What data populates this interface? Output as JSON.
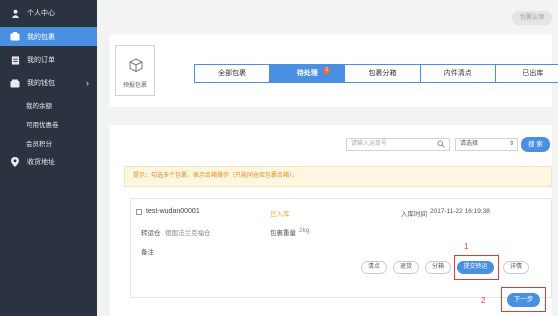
{
  "sidebar": {
    "items": [
      {
        "label": "个人中心",
        "icon": "user-icon"
      },
      {
        "label": "我的包裹",
        "icon": "package-icon"
      },
      {
        "label": "我的订单",
        "icon": "order-icon"
      },
      {
        "label": "我的钱包",
        "icon": "wallet-icon"
      }
    ],
    "wallet_sub": [
      "我的余额",
      "可用优惠卷",
      "会员积分"
    ],
    "address": {
      "label": "收货地址",
      "icon": "location-icon"
    }
  },
  "header": {
    "help_label": "包裹认领"
  },
  "top_card": {
    "pre_package_label": "预报包裹",
    "tabs": [
      {
        "label": "全部包裹"
      },
      {
        "label": "待处理",
        "badge": "1"
      },
      {
        "label": "包裹分箱"
      },
      {
        "label": "内件清点"
      },
      {
        "label": "已出库"
      }
    ]
  },
  "filters": {
    "search_placeholder": "请输入运单号",
    "select_value": "请选择",
    "search_button": "搜 索"
  },
  "tip": "提示：勾选多个包裹，表示合箱操作（只能同仓库包裹合箱）。",
  "package": {
    "tracking_no": "test-wudan00001",
    "status": "已入库",
    "in_time_label": "入库时间",
    "in_time_value": "2017-11-22 16:19:38",
    "warehouse_label": "转运仓",
    "warehouse_value": "德国法兰克福仓",
    "weight_label": "包裹重量",
    "weight_value": "2kg",
    "note_label": "备注",
    "buttons": [
      "清点",
      "退货",
      "分箱",
      "提交转运",
      "详情"
    ]
  },
  "annotations": {
    "one": "1",
    "two": "2"
  },
  "next_button": "下一步",
  "colors": {
    "sidebar_bg": "#2b3340",
    "accent": "#4a90e2",
    "warning": "#f5a623",
    "highlight": "#e53935"
  }
}
